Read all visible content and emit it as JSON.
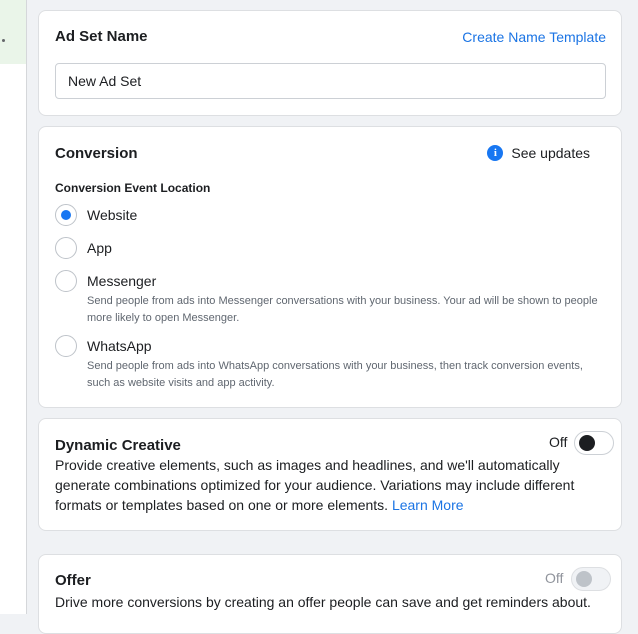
{
  "ad_set_name": {
    "title": "Ad Set Name",
    "create_template_link": "Create Name Template",
    "input_value": "New Ad Set"
  },
  "conversion": {
    "title": "Conversion",
    "updates_link": "See updates",
    "location_label": "Conversion Event Location",
    "options": [
      {
        "label": "Website",
        "selected": true,
        "description": ""
      },
      {
        "label": "App",
        "selected": false,
        "description": ""
      },
      {
        "label": "Messenger",
        "selected": false,
        "description": "Send people from ads into Messenger conversations with your business. Your ad will be shown to people more likely to open Messenger."
      },
      {
        "label": "WhatsApp",
        "selected": false,
        "description": "Send people from ads into WhatsApp conversations with your business, then track conversion events, such as website visits and app activity."
      }
    ]
  },
  "dynamic_creative": {
    "title": "Dynamic Creative",
    "toggle_label": "Off",
    "description": "Provide creative elements, such as images and headlines, and we'll automatically generate combinations optimized for your audience. Variations may include different formats or templates based on one or more elements.",
    "learn_more": "Learn More"
  },
  "offer": {
    "title": "Offer",
    "toggle_label": "Off",
    "description": "Drive more conversions by creating an offer people can save and get reminders about."
  },
  "colors": {
    "accent": "#1877f2",
    "link": "#1b74e4",
    "background": "#f0f2f5"
  }
}
